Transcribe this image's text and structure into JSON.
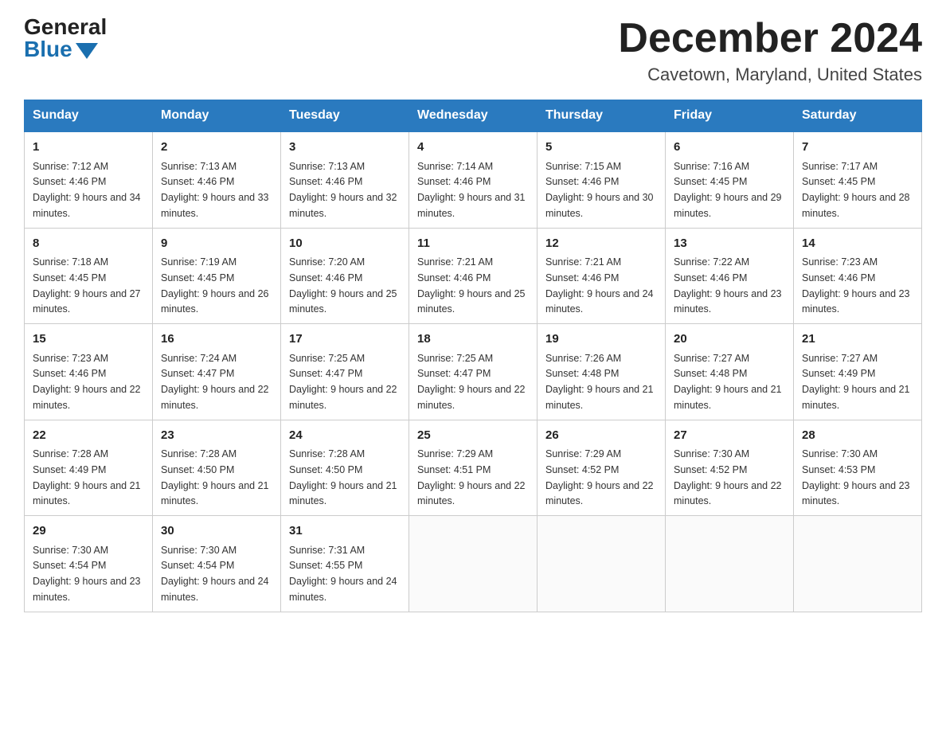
{
  "header": {
    "logo_general": "General",
    "logo_blue": "Blue",
    "month_title": "December 2024",
    "location": "Cavetown, Maryland, United States"
  },
  "days_of_week": [
    "Sunday",
    "Monday",
    "Tuesday",
    "Wednesday",
    "Thursday",
    "Friday",
    "Saturday"
  ],
  "weeks": [
    [
      {
        "num": "1",
        "sunrise": "7:12 AM",
        "sunset": "4:46 PM",
        "daylight": "9 hours and 34 minutes."
      },
      {
        "num": "2",
        "sunrise": "7:13 AM",
        "sunset": "4:46 PM",
        "daylight": "9 hours and 33 minutes."
      },
      {
        "num": "3",
        "sunrise": "7:13 AM",
        "sunset": "4:46 PM",
        "daylight": "9 hours and 32 minutes."
      },
      {
        "num": "4",
        "sunrise": "7:14 AM",
        "sunset": "4:46 PM",
        "daylight": "9 hours and 31 minutes."
      },
      {
        "num": "5",
        "sunrise": "7:15 AM",
        "sunset": "4:46 PM",
        "daylight": "9 hours and 30 minutes."
      },
      {
        "num": "6",
        "sunrise": "7:16 AM",
        "sunset": "4:45 PM",
        "daylight": "9 hours and 29 minutes."
      },
      {
        "num": "7",
        "sunrise": "7:17 AM",
        "sunset": "4:45 PM",
        "daylight": "9 hours and 28 minutes."
      }
    ],
    [
      {
        "num": "8",
        "sunrise": "7:18 AM",
        "sunset": "4:45 PM",
        "daylight": "9 hours and 27 minutes."
      },
      {
        "num": "9",
        "sunrise": "7:19 AM",
        "sunset": "4:45 PM",
        "daylight": "9 hours and 26 minutes."
      },
      {
        "num": "10",
        "sunrise": "7:20 AM",
        "sunset": "4:46 PM",
        "daylight": "9 hours and 25 minutes."
      },
      {
        "num": "11",
        "sunrise": "7:21 AM",
        "sunset": "4:46 PM",
        "daylight": "9 hours and 25 minutes."
      },
      {
        "num": "12",
        "sunrise": "7:21 AM",
        "sunset": "4:46 PM",
        "daylight": "9 hours and 24 minutes."
      },
      {
        "num": "13",
        "sunrise": "7:22 AM",
        "sunset": "4:46 PM",
        "daylight": "9 hours and 23 minutes."
      },
      {
        "num": "14",
        "sunrise": "7:23 AM",
        "sunset": "4:46 PM",
        "daylight": "9 hours and 23 minutes."
      }
    ],
    [
      {
        "num": "15",
        "sunrise": "7:23 AM",
        "sunset": "4:46 PM",
        "daylight": "9 hours and 22 minutes."
      },
      {
        "num": "16",
        "sunrise": "7:24 AM",
        "sunset": "4:47 PM",
        "daylight": "9 hours and 22 minutes."
      },
      {
        "num": "17",
        "sunrise": "7:25 AM",
        "sunset": "4:47 PM",
        "daylight": "9 hours and 22 minutes."
      },
      {
        "num": "18",
        "sunrise": "7:25 AM",
        "sunset": "4:47 PM",
        "daylight": "9 hours and 22 minutes."
      },
      {
        "num": "19",
        "sunrise": "7:26 AM",
        "sunset": "4:48 PM",
        "daylight": "9 hours and 21 minutes."
      },
      {
        "num": "20",
        "sunrise": "7:27 AM",
        "sunset": "4:48 PM",
        "daylight": "9 hours and 21 minutes."
      },
      {
        "num": "21",
        "sunrise": "7:27 AM",
        "sunset": "4:49 PM",
        "daylight": "9 hours and 21 minutes."
      }
    ],
    [
      {
        "num": "22",
        "sunrise": "7:28 AM",
        "sunset": "4:49 PM",
        "daylight": "9 hours and 21 minutes."
      },
      {
        "num": "23",
        "sunrise": "7:28 AM",
        "sunset": "4:50 PM",
        "daylight": "9 hours and 21 minutes."
      },
      {
        "num": "24",
        "sunrise": "7:28 AM",
        "sunset": "4:50 PM",
        "daylight": "9 hours and 21 minutes."
      },
      {
        "num": "25",
        "sunrise": "7:29 AM",
        "sunset": "4:51 PM",
        "daylight": "9 hours and 22 minutes."
      },
      {
        "num": "26",
        "sunrise": "7:29 AM",
        "sunset": "4:52 PM",
        "daylight": "9 hours and 22 minutes."
      },
      {
        "num": "27",
        "sunrise": "7:30 AM",
        "sunset": "4:52 PM",
        "daylight": "9 hours and 22 minutes."
      },
      {
        "num": "28",
        "sunrise": "7:30 AM",
        "sunset": "4:53 PM",
        "daylight": "9 hours and 23 minutes."
      }
    ],
    [
      {
        "num": "29",
        "sunrise": "7:30 AM",
        "sunset": "4:54 PM",
        "daylight": "9 hours and 23 minutes."
      },
      {
        "num": "30",
        "sunrise": "7:30 AM",
        "sunset": "4:54 PM",
        "daylight": "9 hours and 24 minutes."
      },
      {
        "num": "31",
        "sunrise": "7:31 AM",
        "sunset": "4:55 PM",
        "daylight": "9 hours and 24 minutes."
      },
      null,
      null,
      null,
      null
    ]
  ]
}
